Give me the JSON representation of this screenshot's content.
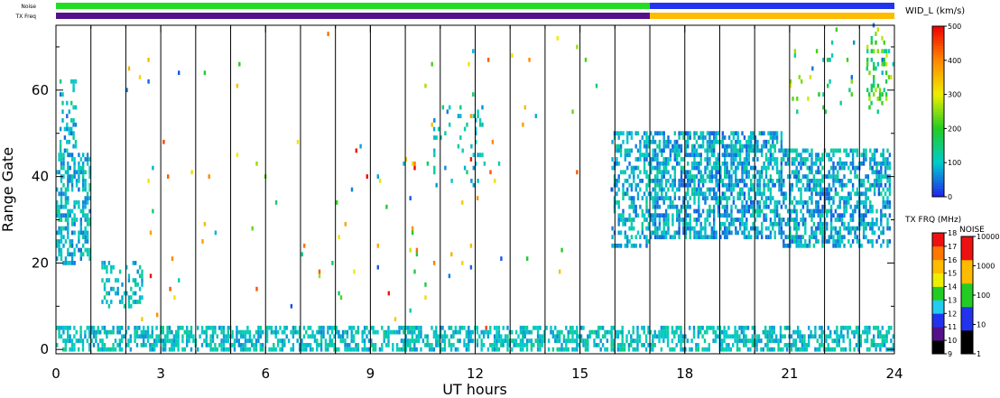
{
  "chart_data": {
    "type": "heatmap",
    "xlabel": "UT hours",
    "ylabel": "Range Gate",
    "xlim": [
      0,
      24
    ],
    "ylim": [
      -1,
      75
    ],
    "x_ticks": [
      0,
      3,
      6,
      9,
      12,
      15,
      18,
      21,
      24
    ],
    "x_tick_labels": [
      "0",
      "3",
      "6",
      "9",
      "12",
      "15",
      "18",
      "21",
      "24"
    ],
    "y_ticks": [
      0,
      20,
      40,
      60
    ],
    "y_tick_labels": [
      "0",
      "20",
      "40",
      "60"
    ],
    "hour_lines": [
      1,
      2,
      3,
      4,
      5,
      6,
      7,
      8,
      9,
      10,
      11,
      12,
      13,
      14,
      15,
      16,
      17,
      18,
      19,
      20,
      21,
      22,
      23
    ],
    "top_strips": {
      "noise_label": "Noise",
      "txfreq_label": "TX Freq",
      "noise_segments": [
        {
          "x0": 0,
          "x1": 17,
          "color": "#22dd22"
        },
        {
          "x0": 17,
          "x1": 24,
          "color": "#2233ee"
        }
      ],
      "txfreq_segments": [
        {
          "x0": 0,
          "x1": 17,
          "color": "#55118a"
        },
        {
          "x0": 17,
          "x1": 24,
          "color": "#ffbb00"
        }
      ]
    },
    "colorbars": [
      {
        "title": "WID_L (km/s)",
        "type": "continuous",
        "tick_labels": [
          "0",
          "100",
          "200",
          "300",
          "400",
          "500"
        ],
        "range": [
          0,
          500
        ],
        "stops": [
          "#2222ee",
          "#00cccc",
          "#22cc22",
          "#eeee00",
          "#ff8800",
          "#ee0000"
        ]
      },
      {
        "title": "TX FRQ (MHz)",
        "type": "discrete",
        "tick_labels": [
          "9",
          "10",
          "11",
          "12",
          "13",
          "14",
          "15",
          "16",
          "17",
          "18"
        ],
        "colors": [
          "#000000",
          "#55118a",
          "#2233ee",
          "#22ccee",
          "#22cc22",
          "#eeee00",
          "#ffbb00",
          "#ff7700",
          "#ee1111"
        ]
      },
      {
        "title": "NOISE",
        "type": "discrete",
        "tick_labels": [
          "1",
          "10",
          "100",
          "1000",
          "10000"
        ],
        "colors": [
          "#000000",
          "#2233ee",
          "#22cc22",
          "#ffbb00",
          "#ee1111"
        ]
      }
    ],
    "scatter_regions": [
      {
        "x": [
          0.0,
          24.0
        ],
        "y": [
          0,
          5
        ],
        "value": [
          60,
          140
        ],
        "density": 0.55
      },
      {
        "x": [
          0.0,
          1.0
        ],
        "y": [
          20,
          45
        ],
        "value": [
          40,
          140
        ],
        "density": 0.5
      },
      {
        "x": [
          0.1,
          0.6
        ],
        "y": [
          45,
          62
        ],
        "value": [
          40,
          150
        ],
        "density": 0.25
      },
      {
        "x": [
          1.3,
          2.5
        ],
        "y": [
          10,
          20
        ],
        "value": [
          60,
          140
        ],
        "density": 0.35
      },
      {
        "x": [
          15.9,
          17.0
        ],
        "y": [
          24,
          50
        ],
        "value": [
          40,
          140
        ],
        "density": 0.45
      },
      {
        "x": [
          17.0,
          20.8
        ],
        "y": [
          26,
          50
        ],
        "value": [
          30,
          140
        ],
        "density": 0.6
      },
      {
        "x": [
          20.8,
          23.9
        ],
        "y": [
          24,
          46
        ],
        "value": [
          30,
          140
        ],
        "density": 0.55
      },
      {
        "x": [
          10.8,
          12.3
        ],
        "y": [
          38,
          56
        ],
        "value": [
          50,
          150
        ],
        "density": 0.12
      },
      {
        "x": [
          23.2,
          23.8
        ],
        "y": [
          55,
          72
        ],
        "value": [
          120,
          280
        ],
        "density": 0.25
      },
      {
        "x": [
          21.0,
          24.0
        ],
        "y": [
          55,
          75
        ],
        "value": [
          30,
          300
        ],
        "density": 0.04
      },
      {
        "x": [
          2.0,
          16.0
        ],
        "y": [
          5,
          74
        ],
        "value": [
          20,
          500
        ],
        "density": 0.008
      }
    ]
  }
}
